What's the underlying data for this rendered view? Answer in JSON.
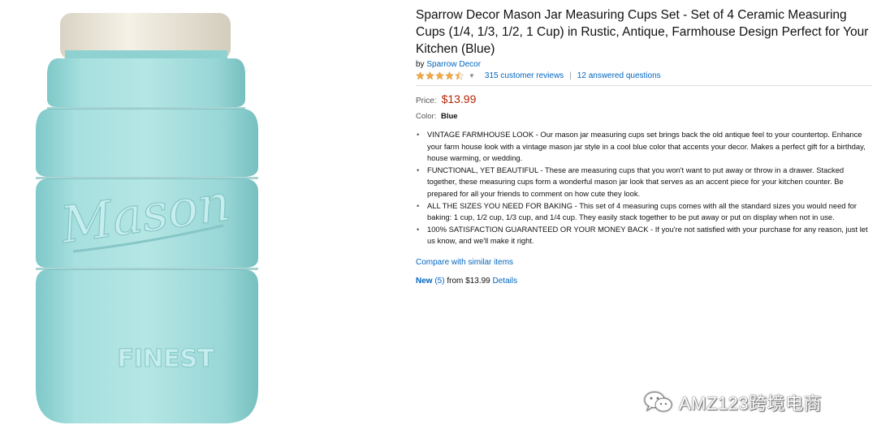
{
  "product": {
    "title": "Sparrow Decor Mason Jar Measuring Cups Set - Set of 4 Ceramic Measuring Cups (1/4, 1/3, 1/2, 1 Cup) in Rustic, Antique, Farmhouse Design Perfect for Your Kitchen (Blue)",
    "by_label": "by",
    "brand": "Sparrow Decor",
    "rating": 4.5,
    "reviews_link": "315 customer reviews",
    "questions_link": "12 answered questions",
    "separator": "|",
    "price_label": "Price:",
    "price": "$13.99",
    "color_label": "Color:",
    "color_value": "Blue",
    "bullets": [
      "VINTAGE FARMHOUSE LOOK - Our mason jar measuring cups set brings back the old antique feel to your countertop. Enhance your farm house look with a vintage mason jar style in a cool blue color that accents your decor. Makes a perfect gift for a birthday, house warming, or wedding.",
      "FUNCTIONAL, YET BEAUTIFUL - These are measuring cups that you won't want to put away or throw in a drawer. Stacked together, these measuring cups form a wonderful mason jar look that serves as an accent piece for your kitchen counter. Be prepared for all your friends to comment on how cute they look.",
      "ALL THE SIZES YOU NEED FOR BAKING - This set of 4 measuring cups comes with all the standard sizes you would need for baking: 1 cup, 1/2 cup, 1/3 cup, and 1/4 cup. They easily stack together to be put away or put on display when not in use.",
      "100% SATISFACTION GUARANTEED OR YOUR MONEY BACK - If you're not satisfied with your purchase for any reason, just let us know, and we'll make it right."
    ],
    "compare_link": "Compare with similar items",
    "new_label": "New",
    "new_count": "(5)",
    "new_from": "from $13.99",
    "details_link": "Details"
  },
  "image": {
    "embossed_text_top": "Mason",
    "embossed_text_bottom": "FINEST",
    "jar_color": "#9fdcdc",
    "lid_color": "#efeadb"
  },
  "watermark": {
    "text": "AMZ123跨境电商",
    "icon": "wechat-icon"
  },
  "colors": {
    "link": "#0066c0",
    "price": "#b12704",
    "star": "#f3a847"
  }
}
